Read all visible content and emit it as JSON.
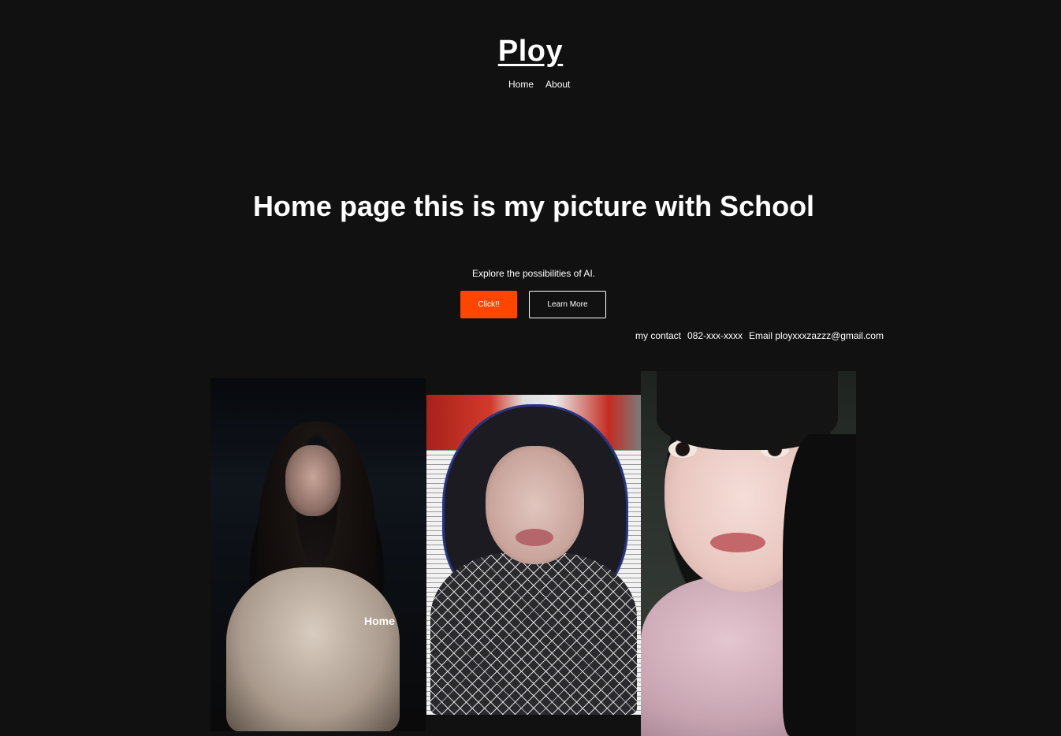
{
  "header": {
    "site_title": "Ploy",
    "nav": {
      "home_label": "Home",
      "about_label": "About"
    }
  },
  "hero": {
    "title": "Home page this is my picture with School",
    "subtitle": "Explore the possibilities of AI.",
    "primary_button": "Click!!",
    "secondary_button": "Learn More"
  },
  "contact": {
    "label": "my contact",
    "phone": "082-xxx-xxxx",
    "email": "Email ployxxxzazzz@gmail.com"
  },
  "gallery": {
    "photo_1_overlay_label": "Home"
  },
  "colors": {
    "background": "#111111",
    "accent": "#ff4500",
    "text": "#ffffff"
  }
}
